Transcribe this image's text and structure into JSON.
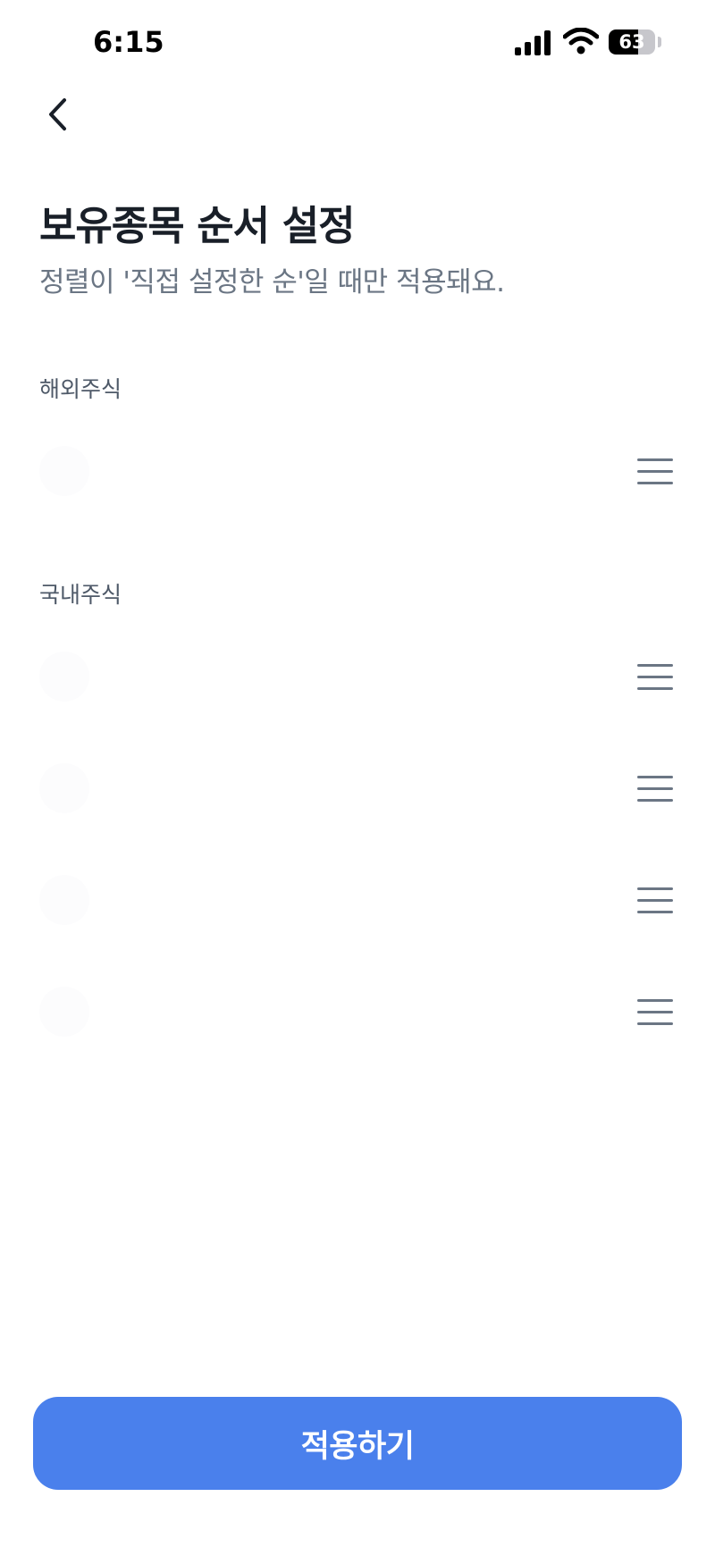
{
  "status_bar": {
    "time": "6:15",
    "battery": "63",
    "battery_level": 0.63,
    "icons": [
      "signal-icon",
      "wifi-icon",
      "battery-icon"
    ]
  },
  "header": {
    "back_icon": "chevron-left-icon",
    "title": "보유종목 순서 설정",
    "subtitle": "정렬이 '직접 설정한 순'일 때만 적용돼요."
  },
  "sections": [
    {
      "label": "해외주식",
      "items": [
        {
          "name": "",
          "handle_icon": "drag-handle-icon"
        }
      ]
    },
    {
      "label": "국내주식",
      "items": [
        {
          "name": "",
          "handle_icon": "drag-handle-icon"
        },
        {
          "name": "",
          "handle_icon": "drag-handle-icon"
        },
        {
          "name": "",
          "handle_icon": "drag-handle-icon"
        },
        {
          "name": "",
          "handle_icon": "drag-handle-icon"
        }
      ]
    }
  ],
  "footer": {
    "apply_label": "적용하기"
  },
  "colors": {
    "accent": "#4a80ec",
    "title": "#191f28",
    "subtitle": "#6b7684",
    "section_label": "#4e5968",
    "handle": "#6b7684"
  }
}
